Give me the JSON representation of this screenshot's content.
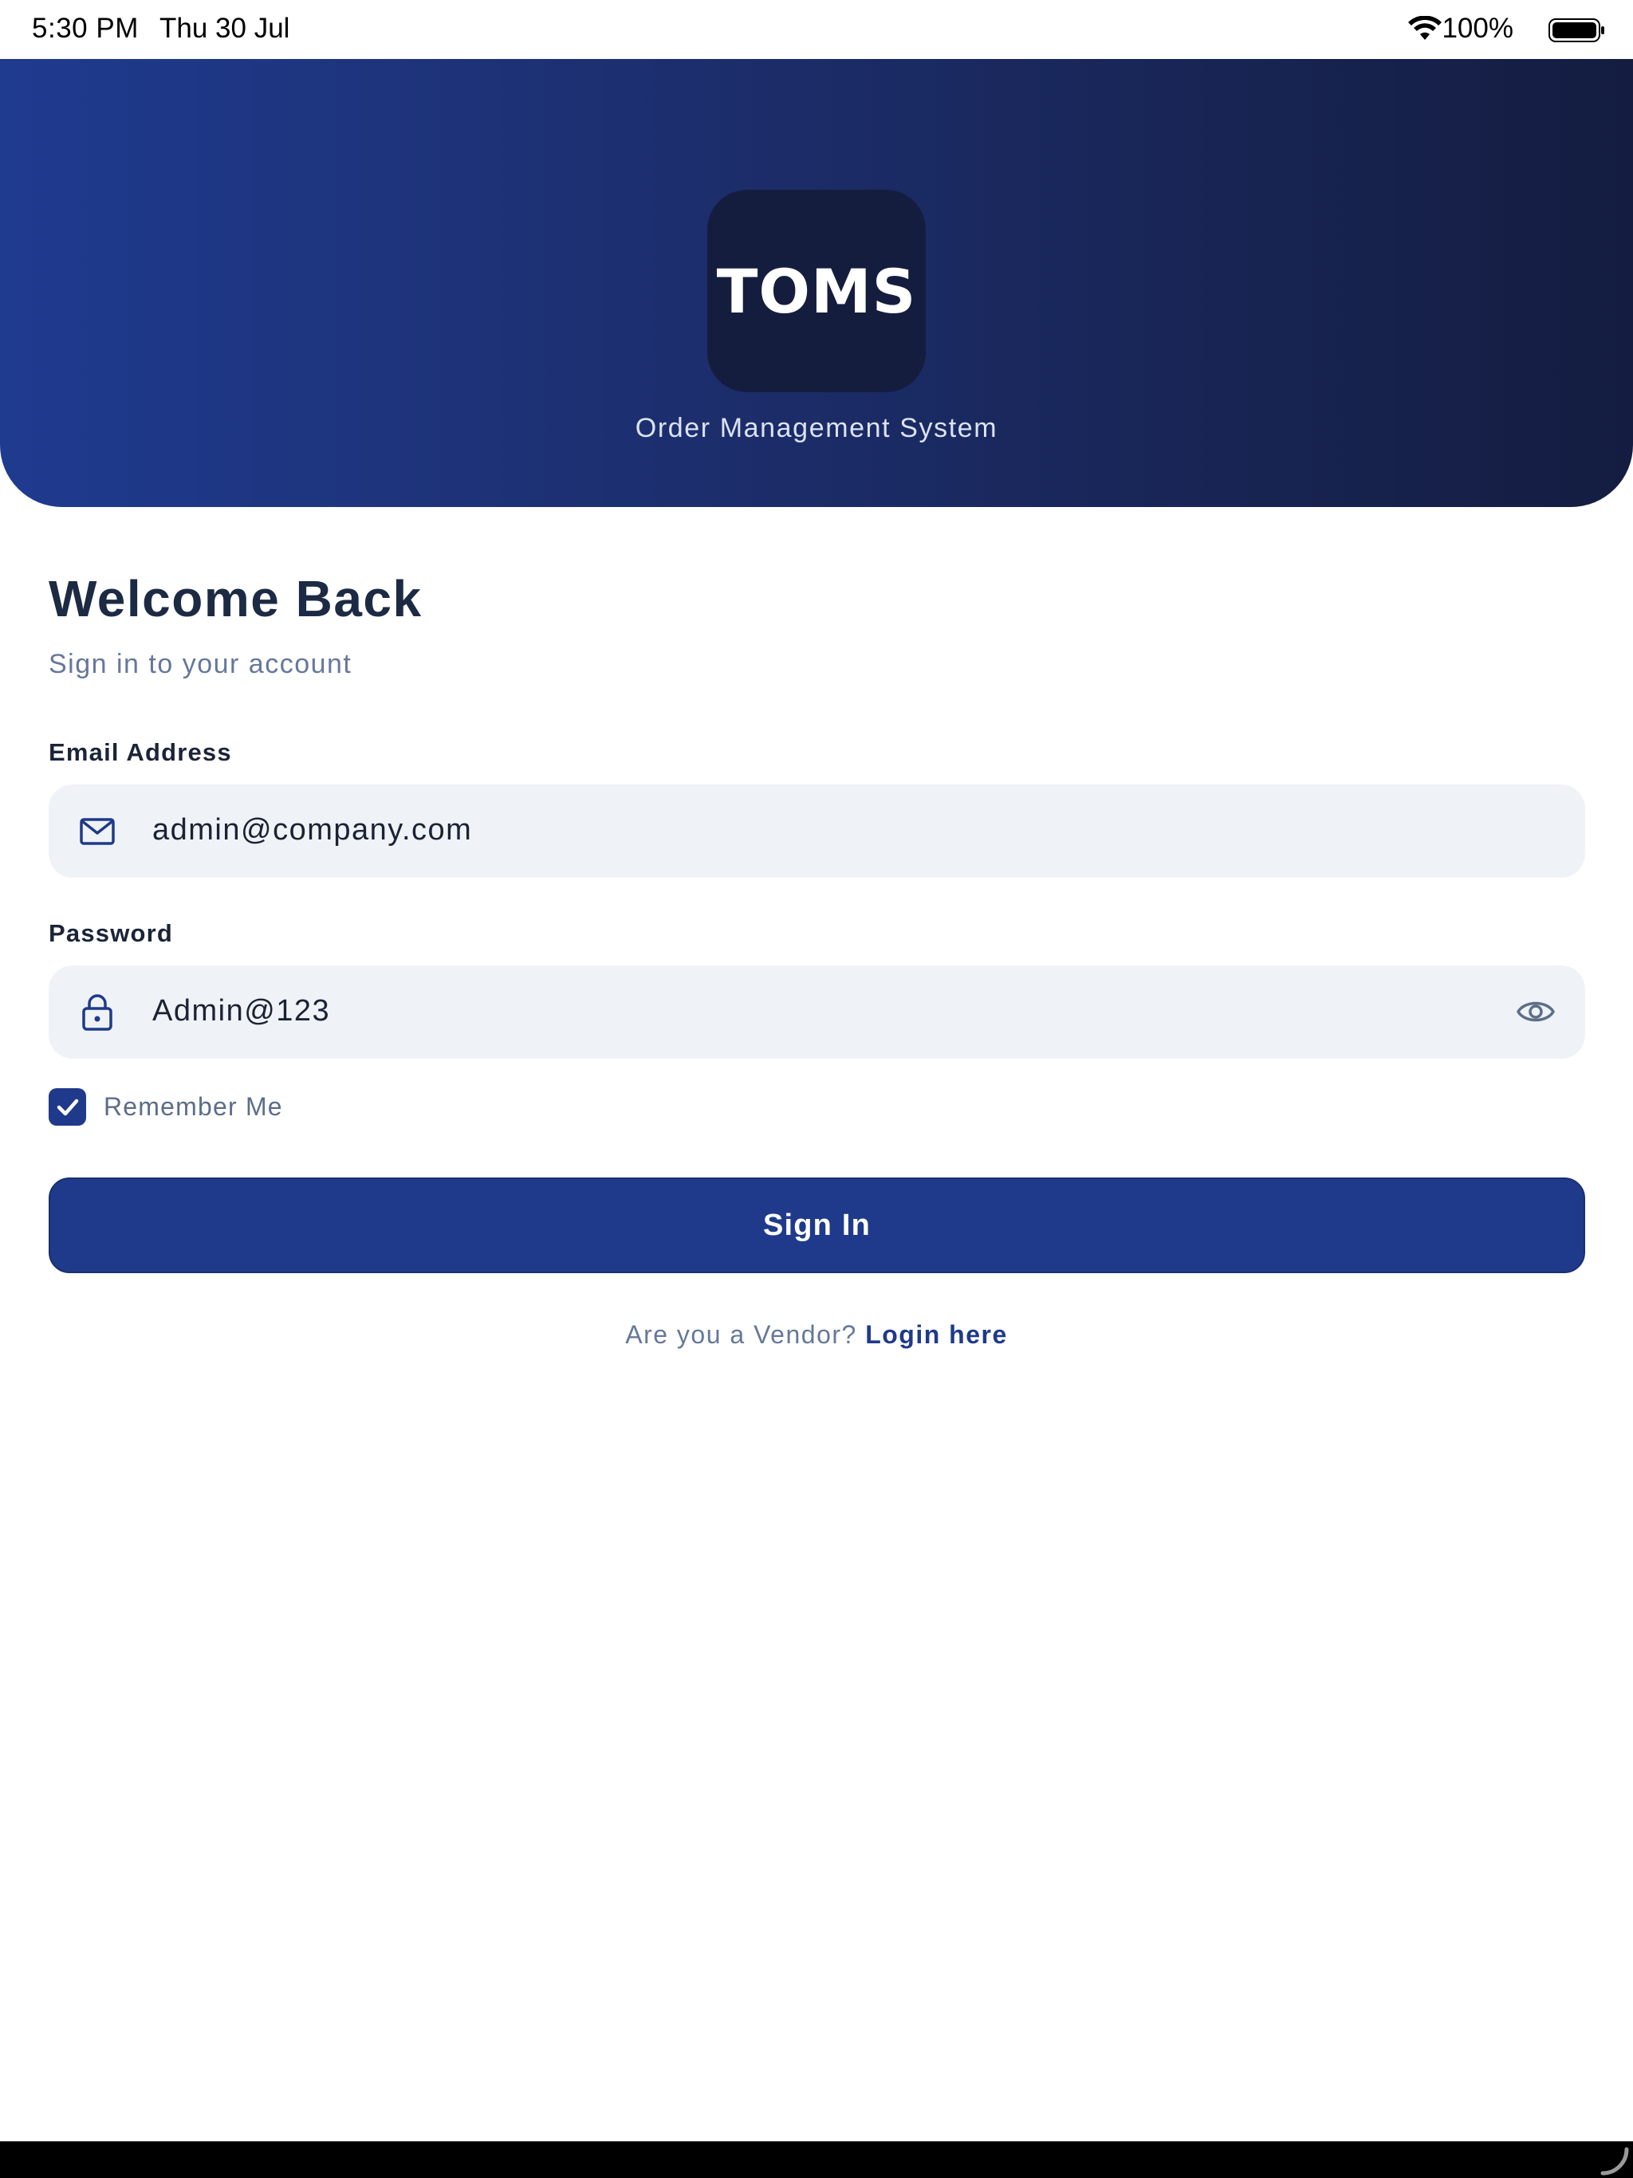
{
  "status_bar": {
    "time": "5:30 PM",
    "date": "Thu 30 Jul",
    "battery": "100%",
    "icons": [
      "wifi-icon",
      "battery-icon"
    ]
  },
  "header": {
    "logo_text": "TOMS",
    "subtitle": "Order Management System"
  },
  "login": {
    "title": "Welcome Back",
    "subtitle": "Sign in to your account",
    "email": {
      "label": "Email Address",
      "value": "admin@company.com",
      "icon": "mail-icon"
    },
    "password": {
      "label": "Password",
      "value": "Admin@123",
      "icon": "lock-icon",
      "toggle_icon": "eye-icon"
    },
    "remember": {
      "label": "Remember Me",
      "checked": true
    },
    "submit_label": "Sign In",
    "vendor_prompt": "Are you a Vendor?",
    "vendor_link": "Login here"
  },
  "colors": {
    "primary": "#1f3a8a",
    "header_start": "#1f3b8f",
    "header_end": "#141d40",
    "logo_tile": "#151d3f",
    "field_bg": "#eff3f8",
    "heading_text": "#1c2a44",
    "muted_text": "#66789a"
  }
}
